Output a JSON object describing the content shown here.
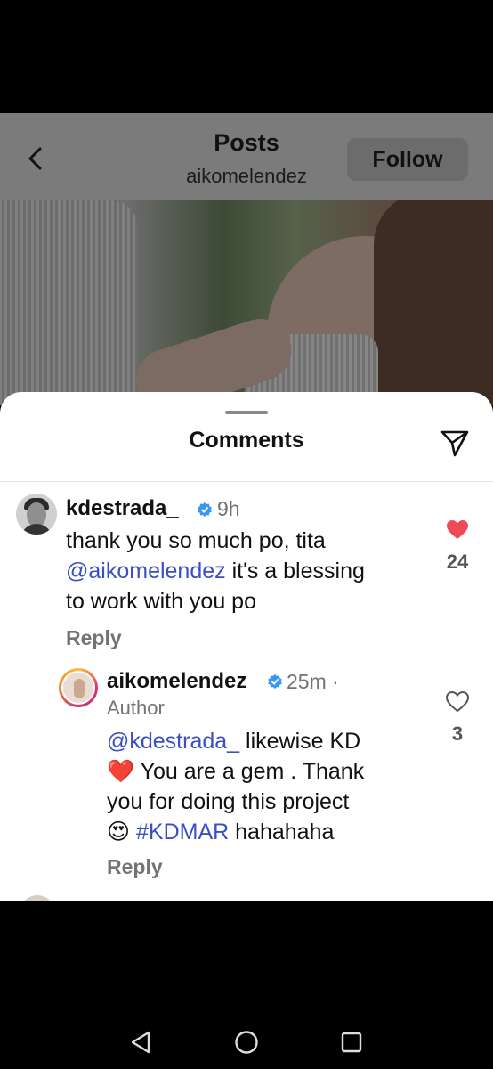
{
  "header": {
    "title": "Posts",
    "subtitle": "aikomelendez",
    "follow_label": "Follow"
  },
  "sheet": {
    "title": "Comments"
  },
  "comments": [
    {
      "username": "kdestrada_",
      "time": "9h",
      "text_line1": "thank you so much po, tita",
      "mention": "@aikomelendez",
      "text_line2_rest": " it's a blessing",
      "text_line3": "to work with you po",
      "reply_label": "Reply",
      "likes": "24",
      "liked": true
    },
    {
      "username": "aikomelendez",
      "time": "25m ·",
      "author_label": "Author",
      "mention": "@kdestrada_",
      "text_line1_rest": " likewise KD",
      "emoji_heart": "❤️",
      "text_line2_rest": " You are a gem . Thank",
      "text_line3": "you for doing this project",
      "emoji_eyes": "😍",
      "hashtag": "#KDMAR",
      "text_line4_rest": " hahahaha",
      "reply_label": "Reply",
      "likes": "3",
      "liked": false
    }
  ],
  "colors": {
    "accent_link": "#3b4fc4",
    "heart_red": "#ed4956",
    "verified_blue": "#3897f0"
  },
  "icons": {
    "back": "chevron-left-icon",
    "share": "paper-plane-icon",
    "verified": "verified-badge-icon",
    "like": "heart-icon",
    "nav_back": "triangle-back-icon",
    "nav_home": "circle-home-icon",
    "nav_recents": "square-recents-icon"
  }
}
